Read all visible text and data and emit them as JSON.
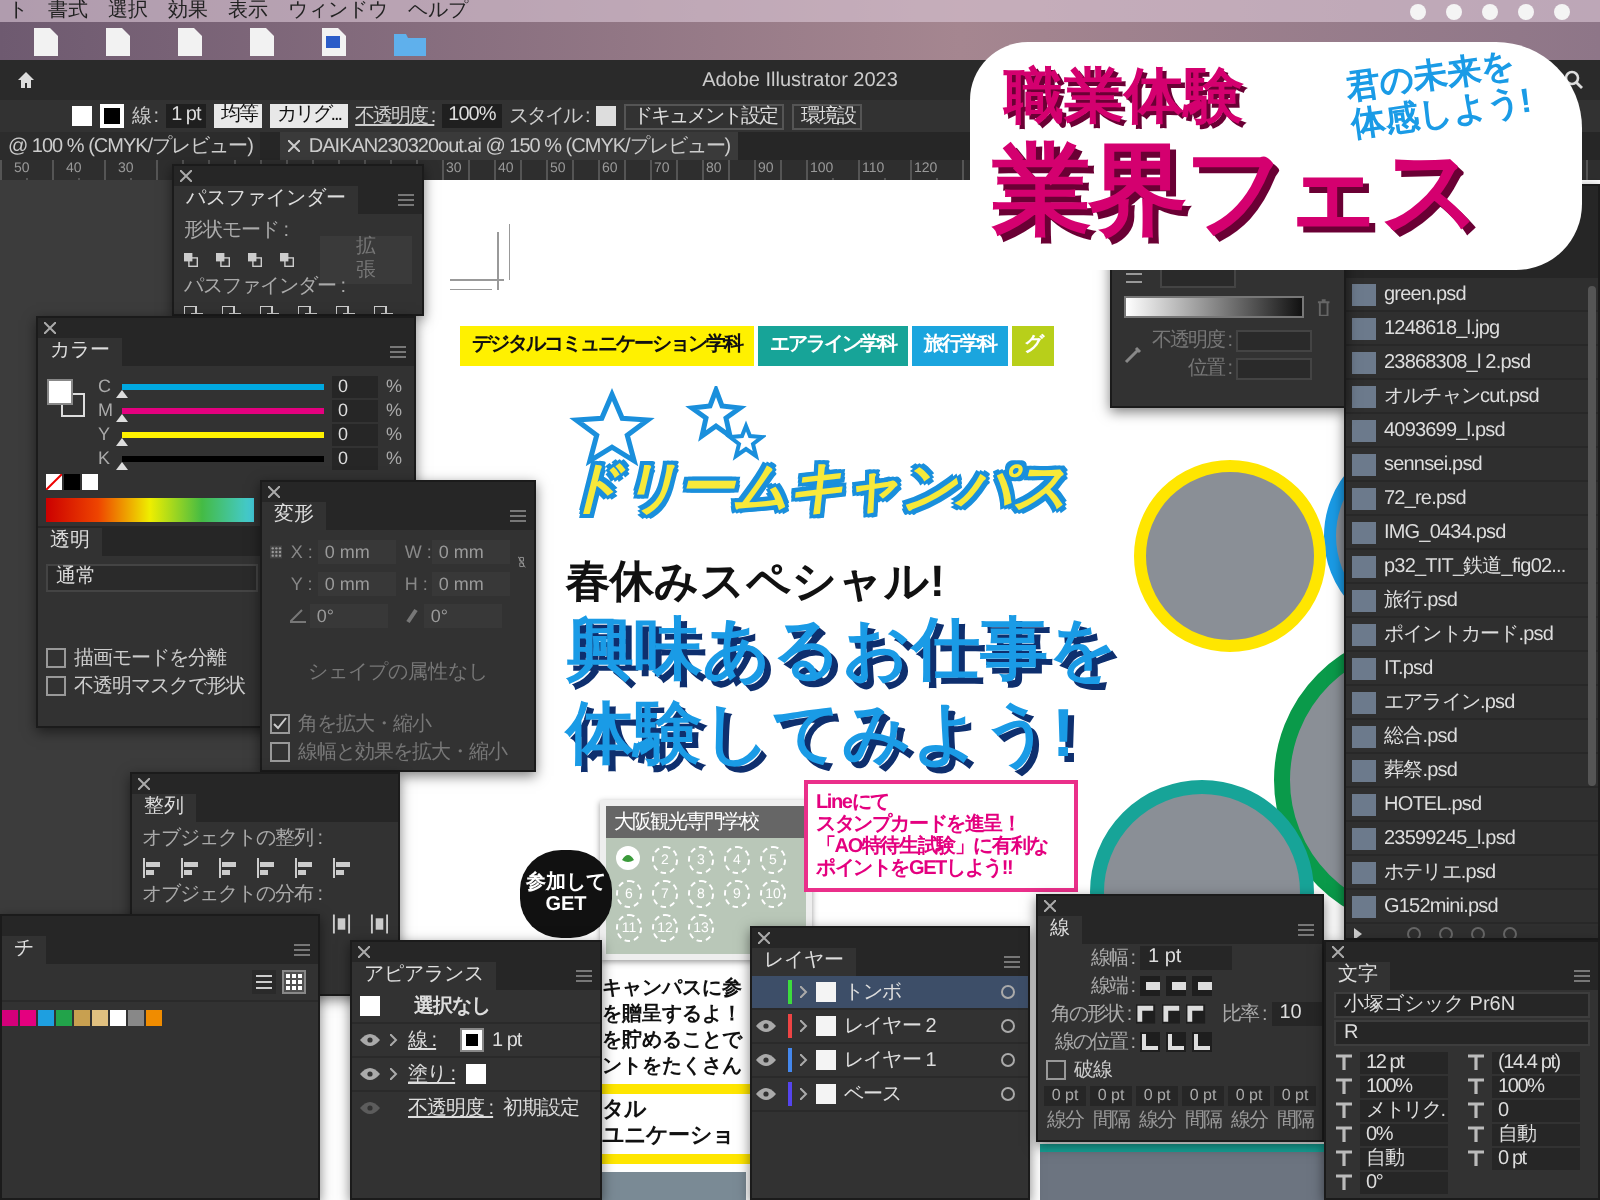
{
  "menubar": {
    "items": [
      "ト",
      "書式",
      "選択",
      "効果",
      "表示",
      "ウィンドウ",
      "ヘルプ"
    ]
  },
  "app": {
    "title": "Adobe Illustrator 2023"
  },
  "control_bar": {
    "stroke_label": "線 :",
    "stroke_weight": "1 pt",
    "profile": "均等",
    "brush": "カリグ...",
    "opacity_label": "不透明度 :",
    "opacity": "100%",
    "style_label": "スタイル :",
    "buttons": [
      "ドキュメント設定",
      "環境設"
    ]
  },
  "doc_tabs": [
    {
      "label": "@ 100 % (CMYK/プレビュー)",
      "selected": false
    },
    {
      "label": "DAIKAN230320out.ai @ 150 % (CMYK/プレビュー)",
      "selected": true
    }
  ],
  "ruler": {
    "left_ticks": [
      "50",
      "40",
      "30"
    ],
    "right_ticks": [
      "30",
      "40",
      "50",
      "60",
      "70",
      "80",
      "90",
      "100",
      "110",
      "120"
    ]
  },
  "artboard": {
    "dept_tabs": [
      {
        "label": "デジタルコミュニケーション学科",
        "color": "#fff100"
      },
      {
        "label": "エアライン学科",
        "color": "#17a498"
      },
      {
        "label": "旅行学科",
        "color": "#1ba5de"
      },
      {
        "label": "グ",
        "color": "#b8cf1a"
      }
    ],
    "logo": "ドリームキャンパス",
    "kicker": "春休みスペシャル!",
    "headline": [
      "興味あるお仕事を",
      "体験してみよう!"
    ],
    "card": {
      "school": "大阪観光専門学校",
      "numbers": [
        "2",
        "3",
        "4",
        "5",
        "6",
        "7",
        "8",
        "9",
        "10",
        "11",
        "12",
        "13"
      ]
    },
    "burst": [
      "参加して",
      "GET"
    ],
    "callout": [
      "Lineにて",
      "スタンプカードを進呈！",
      "「AO特待生試験」に有利な",
      "ポイントをGETしよう!!"
    ],
    "body_lines": [
      "キャンパスに参",
      "を贈呈するよ！",
      "を貯めることで",
      "ントをたくさん"
    ],
    "section_heading": [
      "タル",
      "ユニケーショ"
    ]
  },
  "links": {
    "items": [
      "green.psd",
      "1248618_l.jpg",
      "23868308_l 2.psd",
      "オルチャンcut.psd",
      "4093699_l.psd",
      "sennsei.psd",
      "72_re.psd",
      "IMG_0434.psd",
      "p32_TIT_鉄道_fig02...",
      "旅行.psd",
      "ポイントカード.psd",
      "IT.psd",
      "エアライン.psd",
      "総合.psd",
      "葬祭.psd",
      "HOTEL.psd",
      "23599245_l.psd",
      "ホテリエ.psd",
      "G152mini.psd"
    ]
  },
  "gradient": {
    "opacity_label": "不透明度 :",
    "position_label": "位置 :"
  },
  "pathfinder": {
    "title": "パスファインダー",
    "shape_modes_label": "形状モード :",
    "expand_button": "拡張",
    "pathfinders_label": "パスファインダー :"
  },
  "color": {
    "title": "カラー",
    "channels": [
      {
        "name": "C",
        "value": "0",
        "unit": "%",
        "level": 0,
        "color": "#00a8e0"
      },
      {
        "name": "M",
        "value": "0",
        "unit": "%",
        "level": 0,
        "color": "#e4007f"
      },
      {
        "name": "Y",
        "value": "0",
        "unit": "%",
        "level": 0,
        "color": "#fff100"
      },
      {
        "name": "K",
        "value": "0",
        "unit": "%",
        "level": 0,
        "color": "#000000"
      }
    ]
  },
  "transparency": {
    "title": "透明",
    "blend_mode": "通常",
    "options": [
      {
        "label": "描画モードを分離",
        "checked": false
      },
      {
        "label": "不透明マスクで形状",
        "checked": false
      }
    ]
  },
  "transform": {
    "title": "変形",
    "disabled": true,
    "fields": [
      {
        "label": "X :",
        "value": "0 mm"
      },
      {
        "label": "W :",
        "value": "0 mm"
      },
      {
        "label": "Y :",
        "value": "0 mm"
      },
      {
        "label": "H :",
        "value": "0 mm"
      }
    ],
    "rotate": "0°",
    "shear": "0°",
    "empty_note": "シェイプの属性なし",
    "options": [
      {
        "label": "角を拡大・縮小",
        "checked": true
      },
      {
        "label": "線幅と効果を拡大・縮小",
        "checked": false
      }
    ]
  },
  "align": {
    "title": "整列",
    "align_label": "オブジェクトの整列 :",
    "distribute_label": "オブジェクトの分布 :"
  },
  "swatches": {
    "title": "チ",
    "views": [
      {
        "kind": "list",
        "selected": false
      },
      {
        "kind": "grid",
        "selected": true
      }
    ],
    "swatches": [
      {
        "color": "#d4007a"
      },
      {
        "color": "#e4007f"
      },
      {
        "color": "#1e9fe0"
      },
      {
        "color": "#22a34a"
      },
      {
        "color": "#c8a050"
      },
      {
        "color": "#e0c080"
      },
      {
        "color": "#ffffff"
      },
      {
        "color": "#888888"
      },
      {
        "color": "#f08c00"
      }
    ]
  },
  "appearance": {
    "title": "アピアランス",
    "target": "選択なし",
    "rows": [
      {
        "kind": "stroke",
        "label": "線 :",
        "value": "1 pt"
      },
      {
        "kind": "fill",
        "label": "塗り :"
      },
      {
        "kind": "opacity",
        "label": "不透明度 :",
        "value": "初期設定"
      }
    ]
  },
  "layers": {
    "title": "レイヤー",
    "items": [
      {
        "name": "トンボ",
        "color": "#3ddc3d",
        "visible": false,
        "selected": true
      },
      {
        "name": "レイヤー 2",
        "color": "#ee4444",
        "visible": true,
        "selected": false
      },
      {
        "name": "レイヤー 1",
        "color": "#4488ee",
        "visible": true,
        "selected": false
      },
      {
        "name": "ベース",
        "color": "#5544ee",
        "visible": true,
        "selected": false
      }
    ]
  },
  "stroke": {
    "title": "線",
    "weight_label": "線幅 :",
    "weight": "1 pt",
    "cap_label": "線端 :",
    "corner_label": "角の形状 :",
    "limit_label": "比率 :",
    "limit": "10",
    "align_label": "線の位置 :",
    "dashed": {
      "label": "破線",
      "checked": false
    },
    "dash_fields": [
      {
        "value": "0 pt",
        "label": "線分"
      },
      {
        "value": "0 pt",
        "label": "間隔"
      },
      {
        "value": "0 pt",
        "label": "線分"
      },
      {
        "value": "0 pt",
        "label": "間隔"
      },
      {
        "value": "0 pt",
        "label": "線分"
      },
      {
        "value": "0 pt",
        "label": "間隔"
      }
    ]
  },
  "character": {
    "title": "文字",
    "font": "小塚ゴシック Pr6N",
    "style": "R",
    "fields": [
      "12 pt",
      "(14.4 pt)",
      "100%",
      "100%",
      "メトリク.",
      "0",
      "0%",
      "自動",
      "自動",
      "0 pt",
      "0°"
    ]
  },
  "badge": {
    "title": "職業体験",
    "main": "業界フェス",
    "tagline": [
      "君の未来を",
      "体感しよう!"
    ]
  }
}
